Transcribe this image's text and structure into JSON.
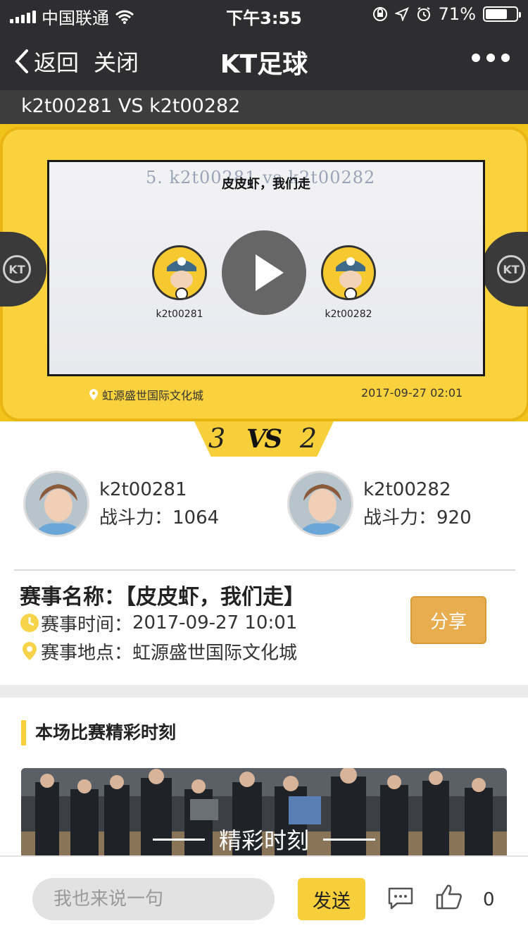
{
  "status_bar": {
    "carrier": "中国联通",
    "time": "下午3:55",
    "battery": "71%",
    "battery_level": 0.71
  },
  "nav": {
    "back_label": "返回",
    "close_label": "关闭",
    "title": "KT足球"
  },
  "match_bar": {
    "title": "k2t00281 VS k2t00282"
  },
  "video": {
    "ghost_text": "5. k2t00281 vs k2t00282",
    "poster_title": "皮皮虾，我们走",
    "left_team": "k2t00281",
    "right_team": "k2t00282",
    "location": "虹源盛世国际文化城",
    "datetime": "2017-09-27 02:01",
    "badge_text": "KT"
  },
  "score": {
    "home": "3",
    "vs": "VS",
    "away": "2"
  },
  "players": [
    {
      "name": "k2t00281",
      "power_label": "战斗力：",
      "power": "1064"
    },
    {
      "name": "k2t00282",
      "power_label": "战斗力：",
      "power": "920"
    }
  ],
  "event": {
    "name_label": "赛事名称：",
    "name": "【皮皮虾，我们走】",
    "time_label": "赛事时间：",
    "time": "2017-09-27 10:01",
    "place_label": "赛事地点：",
    "place": "虹源盛世国际文化城",
    "share_label": "分享"
  },
  "highlights": {
    "section_title": "本场比赛精彩时刻",
    "card_label": "精彩时刻"
  },
  "bottom_bar": {
    "comment_placeholder": "我也来说一句",
    "send_label": "发送",
    "like_count": "0"
  },
  "colors": {
    "nav_bg": "#2e2e30",
    "accent_yellow": "#f7cf3a",
    "share_orange": "#e8ad4f",
    "icon_yellow": "#f7d34a"
  },
  "icons": {
    "signal": "signal-icon",
    "wifi": "wifi-icon",
    "orientation_lock": "orientation-lock-icon",
    "location_arrow": "location-arrow-icon",
    "alarm": "alarm-icon",
    "battery": "battery-icon",
    "back": "chevron-left-icon",
    "more": "more-dots-icon",
    "play": "play-icon",
    "clock": "clock-icon",
    "pin": "map-pin-icon",
    "chat": "chat-bubble-icon",
    "like": "thumbs-up-icon"
  }
}
